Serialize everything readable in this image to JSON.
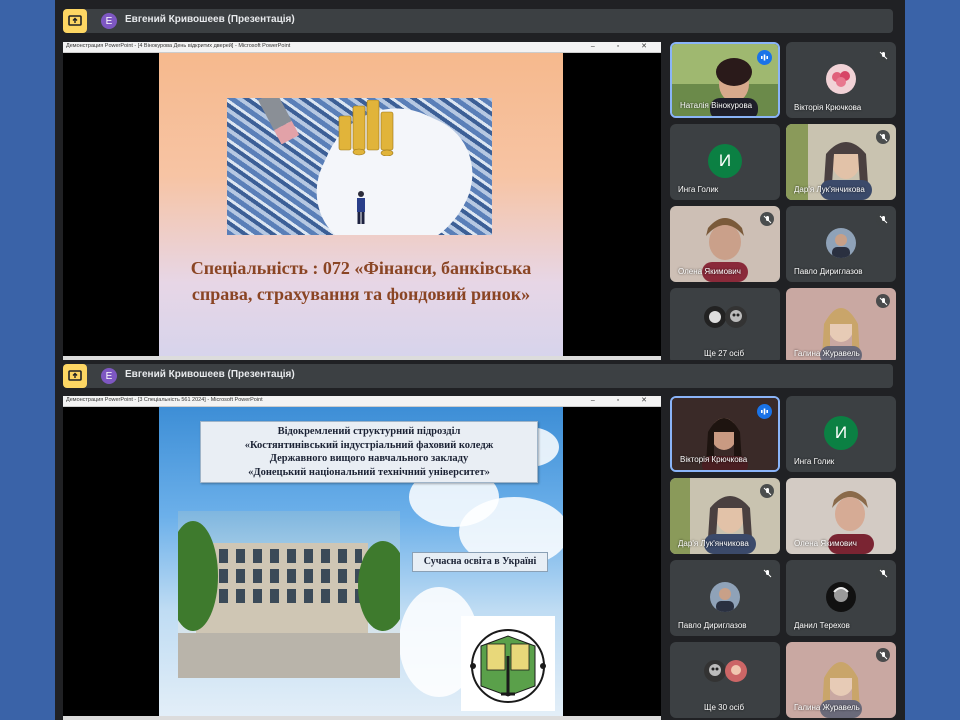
{
  "meeting_1": {
    "presenter": "Евгений Кривошеев (Презентація)",
    "avatar_letter": "Е",
    "window_title": "Демонстрация PowerPoint - [4 Вінокурова День відкритих дверей] - Microsoft PowerPoint",
    "window_controls": "–  ▫  ✕",
    "slide_text_line1": "Спеціальність : 072 «Фінанси, банківська",
    "slide_text_line2": "справа, страхування  та фондовий ринок»",
    "participants": [
      {
        "name": "Наталія Вінокурова",
        "state": "speaking"
      },
      {
        "name": "Вікторія Крючкова",
        "state": "muted"
      },
      {
        "name": "Инга Голик",
        "letter": "И"
      },
      {
        "name": "Дар'я Лук'янчикова",
        "state": "muted"
      },
      {
        "name": "Олена Якимович",
        "state": "muted"
      },
      {
        "name": "Павло Дириглазов",
        "state": "muted"
      },
      {
        "name": "Ще 27 осіб"
      },
      {
        "name": "Галина Журавель",
        "state": "muted"
      }
    ]
  },
  "meeting_2": {
    "presenter": "Евгений Кривошеев (Презентація)",
    "avatar_letter": "Е",
    "window_title": "Демонстрация PowerPoint - [3 Спеціальність 561 2024] - Microsoft PowerPoint",
    "window_controls": "–  ▫  ✕",
    "header_lines": [
      "Відокремлений структурний підрозділ",
      "«Костянтинівський індустріальний фаховий коледж",
      "Державного вищого навчального закладу",
      "«Донецький національний технічний університет»"
    ],
    "label": "Сучасна освіта в Україні",
    "participants": [
      {
        "name": "Вікторія Крючкова",
        "state": "speaking"
      },
      {
        "name": "Инга Голик",
        "letter": "И"
      },
      {
        "name": "Дар'я Лук'янчикова",
        "state": "muted"
      },
      {
        "name": "Олена Якимович"
      },
      {
        "name": "Павло Дириглазов",
        "state": "muted"
      },
      {
        "name": "Данил Терехов",
        "state": "muted"
      },
      {
        "name": "Ще 30 осіб"
      },
      {
        "name": "Галина Журавель",
        "state": "muted"
      }
    ]
  },
  "colors": {
    "background": "#2e5597",
    "meet_dark": "#202124",
    "tile": "#3c4043",
    "active_border": "#8ab4f8",
    "present_yellow": "#fdd663",
    "slide_title": "#8a4524"
  }
}
